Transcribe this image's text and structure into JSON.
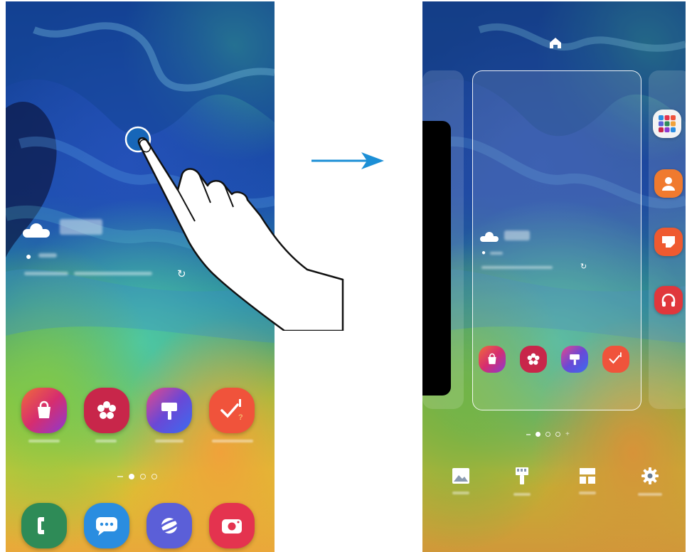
{
  "colors": {
    "arrow": "#1c8fd6",
    "touch_circle": "#1766b8",
    "galaxy_store": "#e4405f",
    "gallery": "#c8264a",
    "theme": "#5b4ec8",
    "reminder": "#f0533b",
    "phone": "#2e8b57",
    "messages": "#2a8de0",
    "internet": "#5b5fd8",
    "camera": "#e4334f",
    "contacts": "#f07a2e",
    "edge_blue": "#ef5a30",
    "music": "#e0373c"
  },
  "left_screen": {
    "home_apps": [
      {
        "icon": "shopping-bag-icon"
      },
      {
        "icon": "flower-icon"
      },
      {
        "icon": "paint-roller-icon"
      },
      {
        "icon": "checkmark-icon"
      }
    ],
    "dock_apps": [
      {
        "icon": "phone-icon"
      },
      {
        "icon": "chat-bubble-icon"
      },
      {
        "icon": "planet-icon"
      },
      {
        "icon": "camera-icon"
      }
    ],
    "page_count": 3,
    "active_page": 1
  },
  "right_screen": {
    "top_icon": "home-icon",
    "edge_apps": [
      {
        "icon": "app-folder-icon"
      },
      {
        "icon": "contact-icon"
      },
      {
        "icon": "note-icon"
      },
      {
        "icon": "headphones-icon"
      }
    ],
    "edit_options": [
      {
        "icon": "image-icon"
      },
      {
        "icon": "paint-roller-icon"
      },
      {
        "icon": "widgets-icon"
      },
      {
        "icon": "gear-icon"
      }
    ]
  }
}
